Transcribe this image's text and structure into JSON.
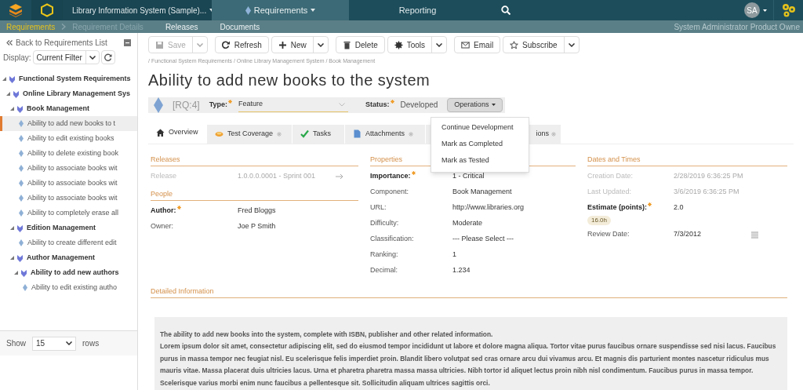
{
  "nav": {
    "project": "Library Information System (Sample)...",
    "tabs": [
      {
        "label": "Requirements",
        "selected": true
      },
      {
        "label": "Reporting",
        "selected": false
      }
    ],
    "avatar": "SA"
  },
  "subnav": {
    "crumbs": [
      {
        "label": "Requirements",
        "kind": "current"
      },
      {
        "label": "Requirement Details",
        "kind": "disabled"
      },
      {
        "label": "Releases",
        "kind": "link"
      },
      {
        "label": "Documents",
        "kind": "link"
      }
    ],
    "user": "System Administrator Product Owne"
  },
  "sidebar": {
    "back": "Back to Requirements List",
    "display_label": "Display:",
    "filter": "Current Filter",
    "tree": [
      {
        "label": "Functional System Requirements",
        "kind": "folder",
        "selected": false,
        "children": [
          {
            "label": "Online Library Management Sys",
            "kind": "folder",
            "selected": false,
            "children": [
              {
                "label": "Book Management",
                "kind": "folder",
                "selected": false,
                "children": [
                  {
                    "label": "Ability to add new books to t",
                    "kind": "leaf",
                    "selected": true
                  },
                  {
                    "label": "Ability to edit existing books",
                    "kind": "leaf",
                    "selected": false
                  },
                  {
                    "label": "Ability to delete existing book",
                    "kind": "leaf",
                    "selected": false
                  },
                  {
                    "label": "Ability to associate books wit",
                    "kind": "leaf",
                    "selected": false
                  },
                  {
                    "label": "Ability to associate books wit",
                    "kind": "leaf",
                    "selected": false
                  },
                  {
                    "label": "Ability to associate books wit",
                    "kind": "leaf",
                    "selected": false
                  },
                  {
                    "label": "Ability to completely erase all",
                    "kind": "leaf",
                    "selected": false
                  }
                ]
              },
              {
                "label": "Edition Management",
                "kind": "folder",
                "selected": false,
                "children": [
                  {
                    "label": "Ability to create different edit",
                    "kind": "leaf",
                    "selected": false
                  }
                ]
              },
              {
                "label": "Author Management",
                "kind": "folder",
                "selected": false,
                "children": [
                  {
                    "label": "Ability to add new authors",
                    "kind": "folder",
                    "selected": false,
                    "children": [
                      {
                        "label": "Ability to edit existing autho",
                        "kind": "leaf",
                        "selected": false
                      }
                    ]
                  }
                ]
              }
            ]
          }
        ]
      }
    ],
    "show_label": "Show",
    "rows_value": "15",
    "rows_label": "rows"
  },
  "toolbar": [
    {
      "label": "Save",
      "kind": "save",
      "disabled": true,
      "dropdown": true
    },
    {
      "label": "Refresh",
      "kind": "refresh",
      "disabled": false,
      "dropdown": false
    },
    {
      "label": "New",
      "kind": "new",
      "disabled": false,
      "dropdown": true
    },
    {
      "label": "Delete",
      "kind": "delete",
      "disabled": false,
      "dropdown": false
    },
    {
      "label": "Tools",
      "kind": "tools",
      "disabled": false,
      "dropdown": true
    },
    {
      "label": "Email",
      "kind": "email",
      "disabled": false,
      "dropdown": false
    },
    {
      "label": "Subscribe",
      "kind": "subscribe",
      "disabled": false,
      "dropdown": true
    }
  ],
  "breadcrumb": "/ Functional System Requirements / Online Library Management System / Book Management",
  "title": "Ability to add new books to the system",
  "header": {
    "id": "[RQ:4]",
    "type_label": "Type:",
    "type_value": "Feature",
    "status_label": "Status:",
    "status_value": "Developed",
    "operations": "Operations",
    "menu": [
      "Continue Development",
      "Mark as Completed",
      "Mark as Tested"
    ]
  },
  "tabs": [
    {
      "label": "Overview",
      "kind": "home",
      "selected": true,
      "marked": false
    },
    {
      "label": "Test Coverage",
      "kind": "coverage",
      "selected": false,
      "marked": true
    },
    {
      "label": "Tasks",
      "kind": "tasks",
      "selected": false,
      "marked": false
    },
    {
      "label": "Attachments",
      "kind": "attachments",
      "selected": false,
      "marked": true
    },
    {
      "label": "ions",
      "kind": "hidden",
      "selected": false,
      "marked": true
    }
  ],
  "columns": [
    {
      "sections": [
        {
          "title": "Releases",
          "fields": [
            {
              "label": "Release",
              "value": "1.0.0.0.0001 - Sprint 001",
              "required": false,
              "disabled": true,
              "kind": "link"
            }
          ]
        },
        {
          "title": "People",
          "fields": [
            {
              "label": "Author:",
              "value": "Fred Bloggs",
              "required": true,
              "disabled": false,
              "kind": "text"
            },
            {
              "label": "Owner:",
              "value": "Joe P Smith",
              "required": false,
              "disabled": false,
              "kind": "text"
            }
          ]
        }
      ]
    },
    {
      "sections": [
        {
          "title": "Properties",
          "fields": [
            {
              "label": "Importance:",
              "value": "1 - Critical",
              "required": true,
              "disabled": false,
              "kind": "text"
            },
            {
              "label": "Component:",
              "value": "Book Management",
              "required": false,
              "disabled": false,
              "kind": "text"
            },
            {
              "label": "URL:",
              "value": "http://www.libraries.org",
              "required": false,
              "disabled": false,
              "kind": "text"
            },
            {
              "label": "Difficulty:",
              "value": "Moderate",
              "required": false,
              "disabled": false,
              "kind": "text"
            },
            {
              "label": "Classification:",
              "value": "--- Please Select ---",
              "required": false,
              "disabled": false,
              "kind": "text"
            },
            {
              "label": "Ranking:",
              "value": "1",
              "required": false,
              "disabled": false,
              "kind": "text"
            },
            {
              "label": "Decimal:",
              "value": "1.234",
              "required": false,
              "disabled": false,
              "kind": "text"
            }
          ]
        }
      ]
    },
    {
      "sections": [
        {
          "title": "Dates and Times",
          "fields": [
            {
              "label": "Creation Date:",
              "value": "2/28/2019 6:36:25 PM",
              "required": false,
              "disabled": true,
              "kind": "text"
            },
            {
              "label": "Last Updated:",
              "value": "3/6/2019 6:36:25 PM",
              "required": false,
              "disabled": true,
              "kind": "text"
            },
            {
              "label": "Estimate (points):",
              "value": "2.0",
              "required": true,
              "disabled": false,
              "kind": "estimate",
              "badge": "16.0h"
            },
            {
              "label": "Review Date:",
              "value": "7/3/2012",
              "required": false,
              "disabled": false,
              "kind": "date"
            }
          ]
        }
      ]
    }
  ],
  "detail_title": "Detailed Information",
  "description": [
    "The ability to add new books into the system, complete with ISBN, publisher and other related information.",
    "Lorem ipsum dolor sit amet, consectetur adipiscing elit, sed do eiusmod tempor incididunt ut labore et dolore magna aliqua. Tortor vitae purus faucibus ornare suspendisse sed nisi lacus. Faucibus purus in massa tempor nec feugiat nisl. Eu scelerisque felis imperdiet proin. Blandit libero volutpat sed cras ornare arcu dui vivamus arcu. Et magnis dis parturient montes nascetur ridiculus mus mauris vitae. Massa placerat duis ultricies lacus. Urna et pharetra pharetra massa massa ultricies. Nibh tortor id aliquet lectus proin nibh nisl condimentum. Faucibus purus in massa tempor. Scelerisque varius morbi enim nunc faucibus a pellentesque sit. Sollicitudin aliquam ultrices sagittis orci."
  ]
}
